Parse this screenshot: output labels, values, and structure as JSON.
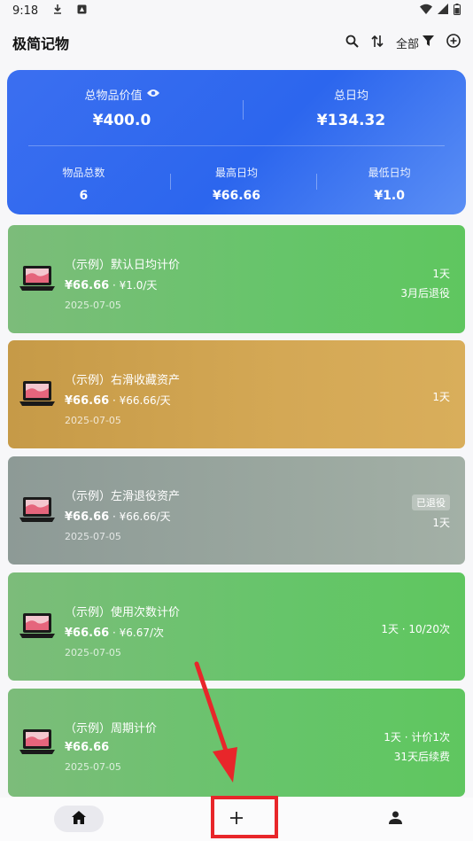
{
  "status_bar": {
    "time": "9:18"
  },
  "app_bar": {
    "title": "极简记物",
    "filter_label": "全部"
  },
  "summary": {
    "total_value_label": "总物品价值",
    "total_value": "¥400.0",
    "total_daily_label": "总日均",
    "total_daily": "¥134.32",
    "count_label": "物品总数",
    "count": "6",
    "max_daily_label": "最高日均",
    "max_daily": "¥66.66",
    "min_daily_label": "最低日均",
    "min_daily": "¥1.0"
  },
  "items": [
    {
      "name": "（示例）默认日均计价",
      "price": "¥66.66",
      "per": " · ¥1.0/天",
      "date": "2025-07-05",
      "right_line1": "1天",
      "right_line2": "3月后退役",
      "badge": "",
      "color": "#66c56a"
    },
    {
      "name": "（示例）右滑收藏资产",
      "price": "¥66.66",
      "per": " · ¥66.66/天",
      "date": "2025-07-05",
      "right_line1": "1天",
      "right_line2": "",
      "badge": "",
      "color": "#d4a855"
    },
    {
      "name": "（示例）左滑退役资产",
      "price": "¥66.66",
      "per": " · ¥66.66/天",
      "date": "2025-07-05",
      "right_line1": "1天",
      "right_line2": "",
      "badge": "已退役",
      "color": "#9aa79f"
    },
    {
      "name": "（示例）使用次数计价",
      "price": "¥66.66",
      "per": " · ¥6.67/次",
      "date": "2025-07-05",
      "right_line1": "1天 · 10/20次",
      "right_line2": "",
      "badge": "",
      "color": "#66c56a"
    },
    {
      "name": "（示例）周期计价",
      "price": "¥66.66",
      "per": "",
      "date": "2025-07-05",
      "right_line1": "1天 · 计价1次",
      "right_line2": "31天后续费",
      "badge": "",
      "color": "#66c56a"
    }
  ],
  "bottom_nav": {
    "add_label": "+"
  },
  "colors": {
    "summary_blue": "#2c66ee",
    "highlight_red": "#e8262a"
  }
}
